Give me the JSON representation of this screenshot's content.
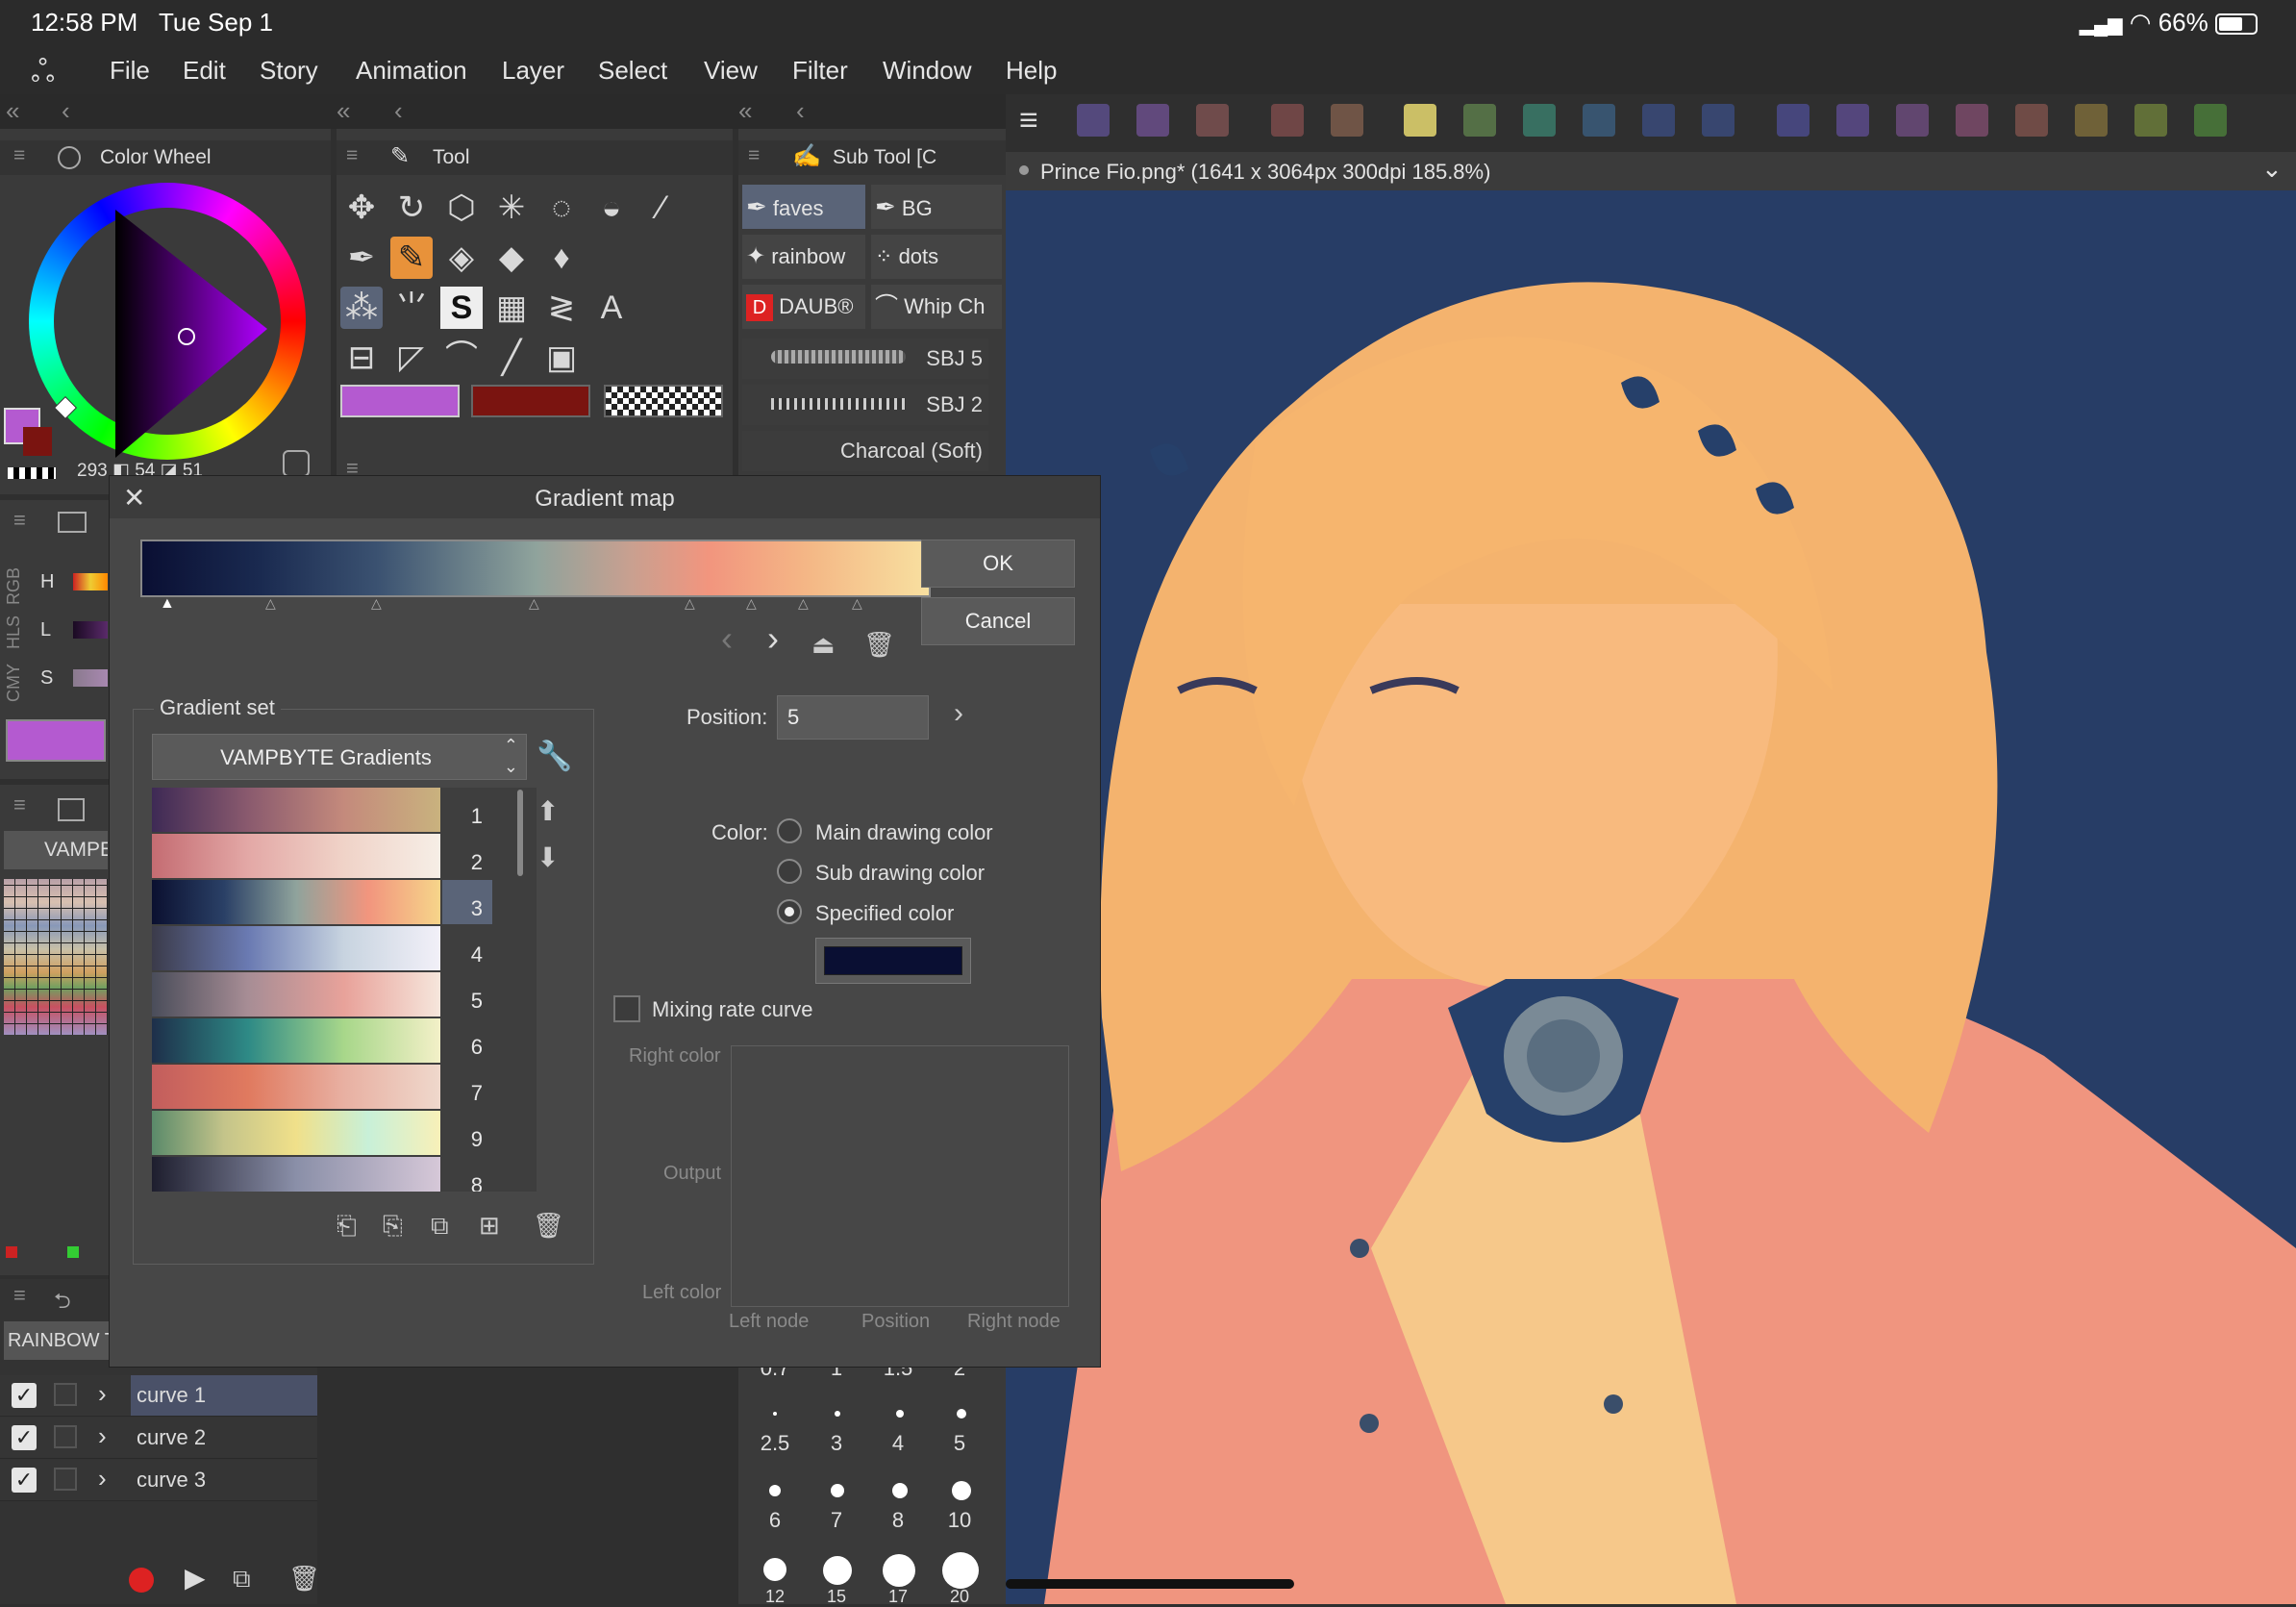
{
  "status": {
    "time": "12:58 PM",
    "date": "Tue Sep 1",
    "battery": "66%"
  },
  "menu": [
    "File",
    "Edit",
    "Story",
    "Animation",
    "Layer",
    "Select",
    "View",
    "Filter",
    "Window",
    "Help"
  ],
  "panels": {
    "color_wheel": {
      "title": "Color Wheel",
      "readout": "293 ◧ 54 ◪ 51"
    },
    "tool": {
      "title": "Tool"
    },
    "sub_tool": {
      "title": "Sub Tool [C",
      "items": [
        "faves",
        "BG",
        "rainbow",
        "dots",
        "DAUB®",
        "Whip Ch"
      ],
      "brushes": [
        "SBJ 5",
        "SBJ 2",
        "Charcoal (Soft)"
      ]
    },
    "color_slider": {
      "tabs": [
        "RGB",
        "HLS",
        "CMY"
      ],
      "rows": [
        "H",
        "L",
        "S"
      ]
    },
    "color_set": {
      "label": "VAMPE"
    },
    "autoaction": {
      "label": "RAINBOW TO"
    },
    "curves": [
      "curve 1",
      "curve 2",
      "curve 3"
    ],
    "brush_sizes": [
      "0.7",
      "1",
      "1.5",
      "2",
      "2.5",
      "3",
      "4",
      "5",
      "6",
      "7",
      "8",
      "10",
      "12",
      "15",
      "17",
      "20"
    ]
  },
  "canvas": {
    "doc_title": "Prince Fio.png* (1641 x 3064px 300dpi 185.8%)",
    "background": "#273d66"
  },
  "dialog": {
    "title": "Gradient map",
    "ok": "OK",
    "cancel": "Cancel",
    "gradient_set_label": "Gradient set",
    "gradient_set_value": "VAMPBYTE Gradients",
    "gradients": [
      {
        "num": "1",
        "colors": [
          "#3e2a55",
          "#8a5a6e",
          "#c48a7c",
          "#c9b27e"
        ]
      },
      {
        "num": "2",
        "colors": [
          "#c46c72",
          "#e3a8a6",
          "#f0d3c8",
          "#f6eee6"
        ]
      },
      {
        "num": "3",
        "colors": [
          "#0b1030",
          "#2a4066",
          "#8fa39c",
          "#f2957e",
          "#f6d58a"
        ]
      },
      {
        "num": "4",
        "colors": [
          "#3b3b4a",
          "#6a7ab2",
          "#c8d4e0",
          "#f2f0f8"
        ]
      },
      {
        "num": "5",
        "colors": [
          "#4a4d5a",
          "#a78d95",
          "#e8a29a",
          "#f6e6dc"
        ]
      },
      {
        "num": "6",
        "colors": [
          "#1e2f4a",
          "#2e8a86",
          "#a8d78a",
          "#f3f0c8"
        ]
      },
      {
        "num": "7",
        "colors": [
          "#c25d5d",
          "#e07a5f",
          "#e8b0a2",
          "#efd8cc"
        ]
      },
      {
        "num": "9",
        "colors": [
          "#5a8a6a",
          "#c4c48a",
          "#f0e08a",
          "#c8f0d8",
          "#f8f0b8"
        ]
      },
      {
        "num": "8",
        "colors": [
          "#1e1e2e",
          "#8a8fa8",
          "#d6c8d8"
        ]
      }
    ],
    "selected_gradient": "3",
    "position_label": "Position:",
    "position_value": "5",
    "color_label": "Color:",
    "radio_options": [
      "Main drawing color",
      "Sub drawing color",
      "Specified color"
    ],
    "selected_radio": "Specified color",
    "specified_color": "#0a0f33",
    "mixing_rate_curve": "Mixing rate curve",
    "curve_labels": {
      "right_color": "Right color",
      "output": "Output",
      "left_color": "Left color",
      "left_node": "Left node",
      "position": "Position",
      "right_node": "Right node"
    }
  },
  "colors": {
    "main": "#b45ad0",
    "sub": "#7a1410",
    "accent_orange": "#e8923a"
  }
}
